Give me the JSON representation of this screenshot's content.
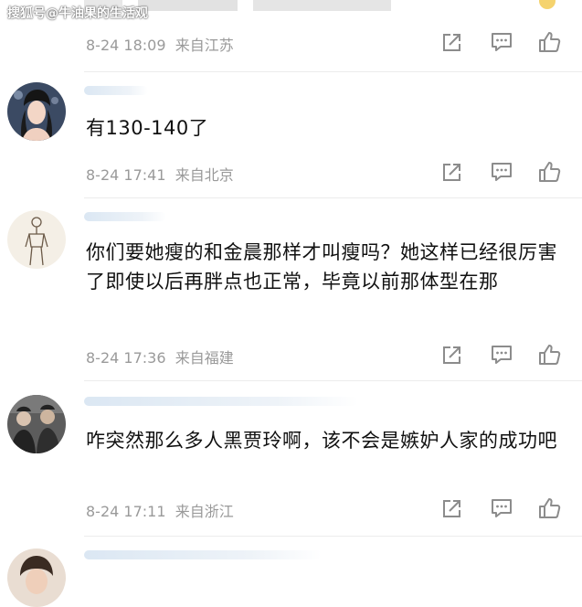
{
  "watermark": "搜狐号@牛油果的生活观",
  "comments": [
    {
      "text": "",
      "time": "8-24 18:09",
      "location": "来自江苏"
    },
    {
      "text": "有130-140了",
      "time": "8-24 17:41",
      "location": "来自北京"
    },
    {
      "text": "你们要她瘦的和金晨那样才叫瘦吗？她这样已经很厉害了即使以后再胖点也正常，毕竟以前那体型在那",
      "time": "8-24 17:36",
      "location": "来自福建"
    },
    {
      "text": "咋突然那么多人黑贾玲啊，该不会是嫉妒人家的成功吧",
      "time": "8-24 17:11",
      "location": "来自浙江"
    }
  ],
  "icons": {
    "share": "share-icon",
    "comment": "comment-icon",
    "like": "thumbs-up-icon"
  },
  "colors": {
    "meta_text": "#9a9a9a",
    "icon_stroke": "#8c8c8c",
    "body_text": "#111111"
  }
}
